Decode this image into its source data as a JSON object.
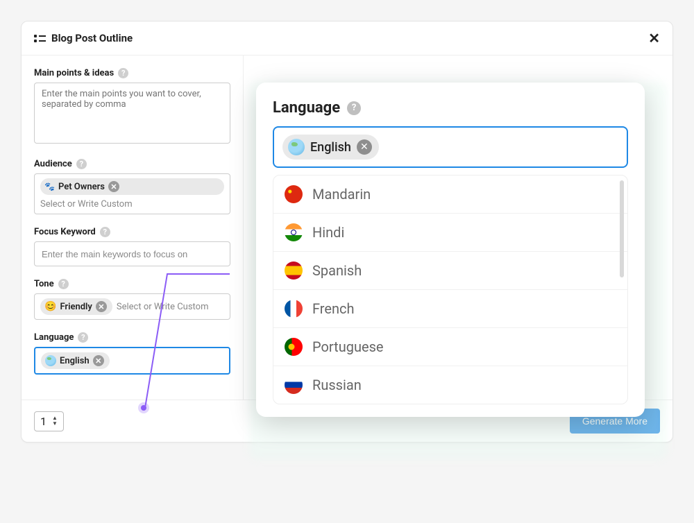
{
  "header": {
    "title": "Blog Post Outline"
  },
  "fields": {
    "mainPoints": {
      "label": "Main points & ideas",
      "placeholder": "Enter the main points you want to cover, separated by comma"
    },
    "audience": {
      "label": "Audience",
      "tag": "Pet Owners",
      "placeholder": "Select or Write Custom"
    },
    "focusKeyword": {
      "label": "Focus Keyword",
      "placeholder": "Enter the main keywords to focus on"
    },
    "tone": {
      "label": "Tone",
      "tag": "Friendly",
      "placeholder": "Select or Write Custom"
    },
    "language": {
      "label": "Language",
      "tag": "English"
    }
  },
  "footer": {
    "count": "1",
    "button": "Generate More"
  },
  "overlay": {
    "title": "Language",
    "selected": "English",
    "options": [
      {
        "label": "Mandarin",
        "flag": "cn"
      },
      {
        "label": "Hindi",
        "flag": "in"
      },
      {
        "label": "Spanish",
        "flag": "es"
      },
      {
        "label": "French",
        "flag": "fr"
      },
      {
        "label": "Portuguese",
        "flag": "pt"
      },
      {
        "label": "Russian",
        "flag": "ru"
      }
    ]
  }
}
